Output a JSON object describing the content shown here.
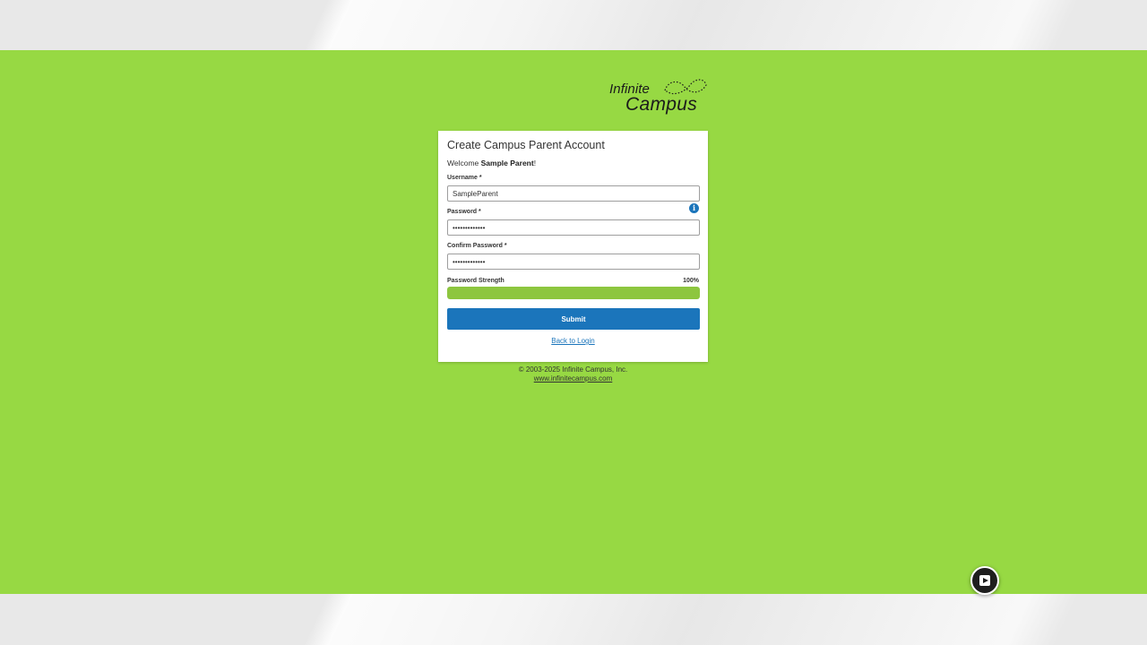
{
  "logo": {
    "word1": "Infinite",
    "word2": "Campus"
  },
  "form": {
    "title": "Create Campus Parent Account",
    "welcome_prefix": "Welcome ",
    "welcome_name": "Sample Parent",
    "welcome_suffix": "!",
    "username": {
      "label": "Username",
      "required_mark": "*",
      "value": "SampleParent"
    },
    "password": {
      "label": "Password",
      "required_mark": "*",
      "value": "•••••••••••••",
      "info_icon": "info-icon"
    },
    "confirm_password": {
      "label": "Confirm Password",
      "required_mark": "*",
      "value": "•••••••••••••"
    },
    "strength": {
      "label": "Password Strength",
      "percent_text": "100%",
      "percent": 100
    },
    "submit_label": "Submit",
    "back_link": "Back to Login"
  },
  "footer": {
    "copyright": "© 2003-2025 Infinite Campus, Inc.",
    "website": "www.infinitecampus.com"
  },
  "colors": {
    "background_green": "#97d943",
    "primary_blue": "#1b75bb",
    "strength_green": "#8dc63f"
  },
  "corner_button_icon": "app-switch-icon"
}
